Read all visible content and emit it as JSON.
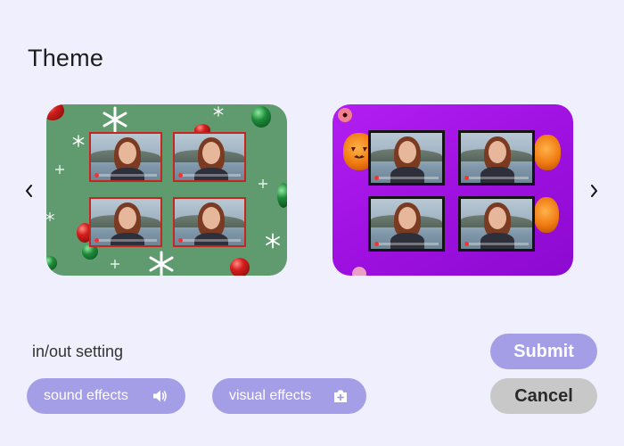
{
  "page": {
    "title": "Theme"
  },
  "themes": [
    {
      "name": "christmas",
      "tile_count": 4
    },
    {
      "name": "halloween",
      "tile_count": 4
    }
  ],
  "nav": {
    "prev_icon": "chevron-left-icon",
    "next_icon": "chevron-right-icon"
  },
  "settings": {
    "label": "in/out setting",
    "sound_effects": {
      "label": "sound effects",
      "icon": "speaker-icon"
    },
    "visual_effects": {
      "label": "visual effects",
      "icon": "camera-icon"
    }
  },
  "actions": {
    "submit_label": "Submit",
    "cancel_label": "Cancel"
  },
  "colors": {
    "accent": "#a49ee6",
    "background": "#f0effd",
    "cancel": "#c8c8c8",
    "christmas_bg": "#5f9b6e",
    "halloween_bg": "#9d10df"
  }
}
